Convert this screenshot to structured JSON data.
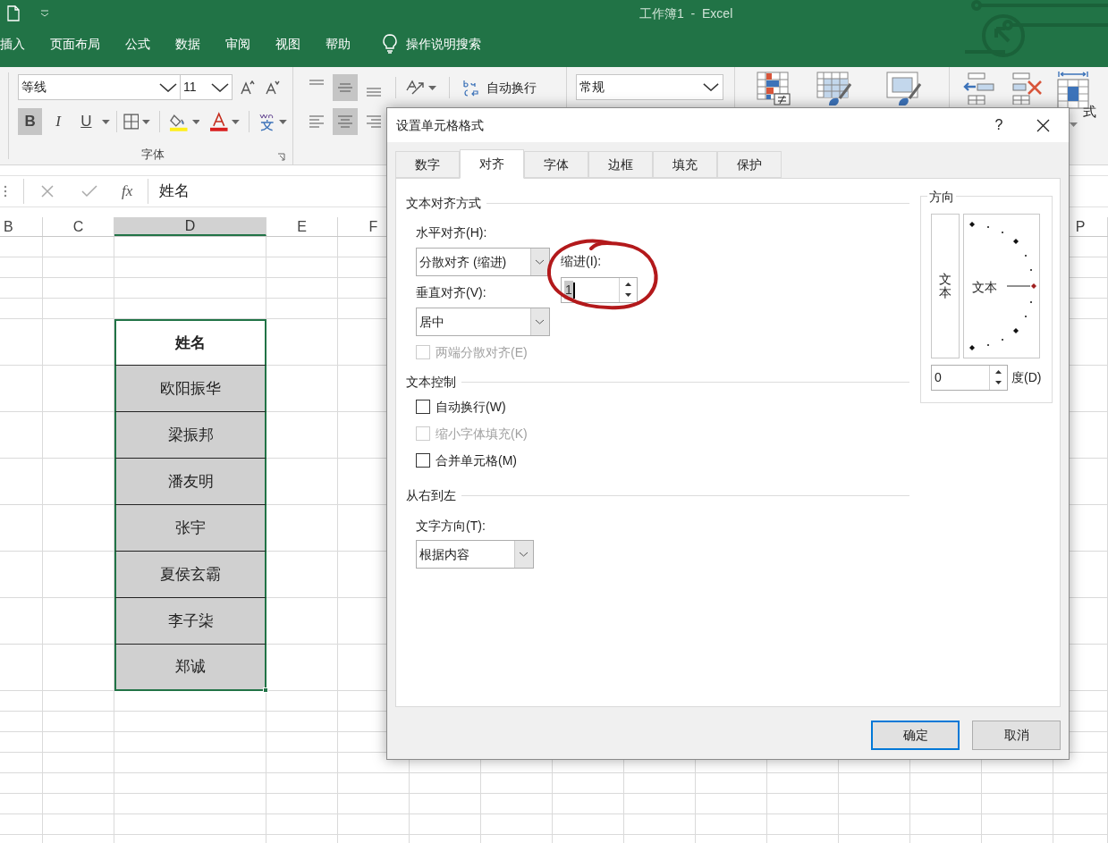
{
  "window": {
    "title": "工作簿1  -  Excel"
  },
  "ribbon_tabs": [
    {
      "label": "插入"
    },
    {
      "label": "页面布局"
    },
    {
      "label": "公式"
    },
    {
      "label": "数据"
    },
    {
      "label": "审阅"
    },
    {
      "label": "视图"
    },
    {
      "label": "帮助"
    }
  ],
  "tell_me": {
    "placeholder": "操作说明搜索"
  },
  "ribbon": {
    "font": {
      "name": "等线",
      "size": "11",
      "label": "字体",
      "style_buttons": [
        {
          "label": "B",
          "kind": "bold",
          "selected": true
        },
        {
          "label": "I",
          "kind": "italic",
          "selected": false
        },
        {
          "label": "U",
          "kind": "underline",
          "selected": false
        }
      ]
    },
    "alignment": {
      "vertical": [
        {
          "kind": "top",
          "selected": false
        },
        {
          "kind": "middle",
          "selected": true
        },
        {
          "kind": "bottom",
          "selected": false
        }
      ],
      "horizontal": [
        {
          "kind": "left",
          "selected": false
        },
        {
          "kind": "center",
          "selected": true
        },
        {
          "kind": "right",
          "selected": false
        }
      ],
      "wrap_text": "自动换行"
    },
    "number": {
      "format": "常规"
    },
    "cells": {
      "format_label": "式"
    }
  },
  "formula_bar": {
    "function_label": "fx",
    "value": "姓名"
  },
  "sheet": {
    "columns": [
      {
        "letter": "B",
        "selected": false
      },
      {
        "letter": "C",
        "selected": false
      },
      {
        "letter": "D",
        "selected": true
      },
      {
        "letter": "E",
        "selected": false
      },
      {
        "letter": "F",
        "selected": false
      },
      {
        "letter": "P",
        "selected": false
      }
    ],
    "table": {
      "header": "姓名",
      "rows": [
        "欧阳振华",
        "梁振邦",
        "潘友明",
        "张宇",
        "夏侯玄霸",
        "李子柒",
        "郑诚"
      ]
    }
  },
  "dialog": {
    "title": "设置单元格格式",
    "help": "?",
    "tabs": [
      {
        "label": "数字",
        "selected": false
      },
      {
        "label": "对齐",
        "selected": true
      },
      {
        "label": "字体",
        "selected": false
      },
      {
        "label": "边框",
        "selected": false
      },
      {
        "label": "填充",
        "selected": false
      },
      {
        "label": "保护",
        "selected": false
      }
    ],
    "alignment_section": "文本对齐方式",
    "horizontal": {
      "label": "水平对齐(H):",
      "value": "分散对齐 (缩进)"
    },
    "indent": {
      "label": "缩进(I):",
      "value": "1"
    },
    "vertical": {
      "label": "垂直对齐(V):",
      "value": "居中"
    },
    "justify_distributed": {
      "label": "两端分散对齐(E)",
      "checked": false,
      "disabled": true
    },
    "text_control_section": "文本控制",
    "text_control": [
      {
        "label": "自动换行(W)",
        "checked": false,
        "disabled": false
      },
      {
        "label": "缩小字体填充(K)",
        "checked": false,
        "disabled": true
      },
      {
        "label": "合并单元格(M)",
        "checked": false,
        "disabled": false
      }
    ],
    "rtl_section": "从右到左",
    "text_direction": {
      "label": "文字方向(T):",
      "value": "根据内容"
    },
    "orientation": {
      "title": "方向",
      "vertical_text": "文本",
      "dial_text": "文本",
      "degrees": "0",
      "degrees_label": "度(D)"
    },
    "buttons": [
      {
        "label": "确定",
        "default": true
      },
      {
        "label": "取消",
        "default": false
      }
    ]
  }
}
